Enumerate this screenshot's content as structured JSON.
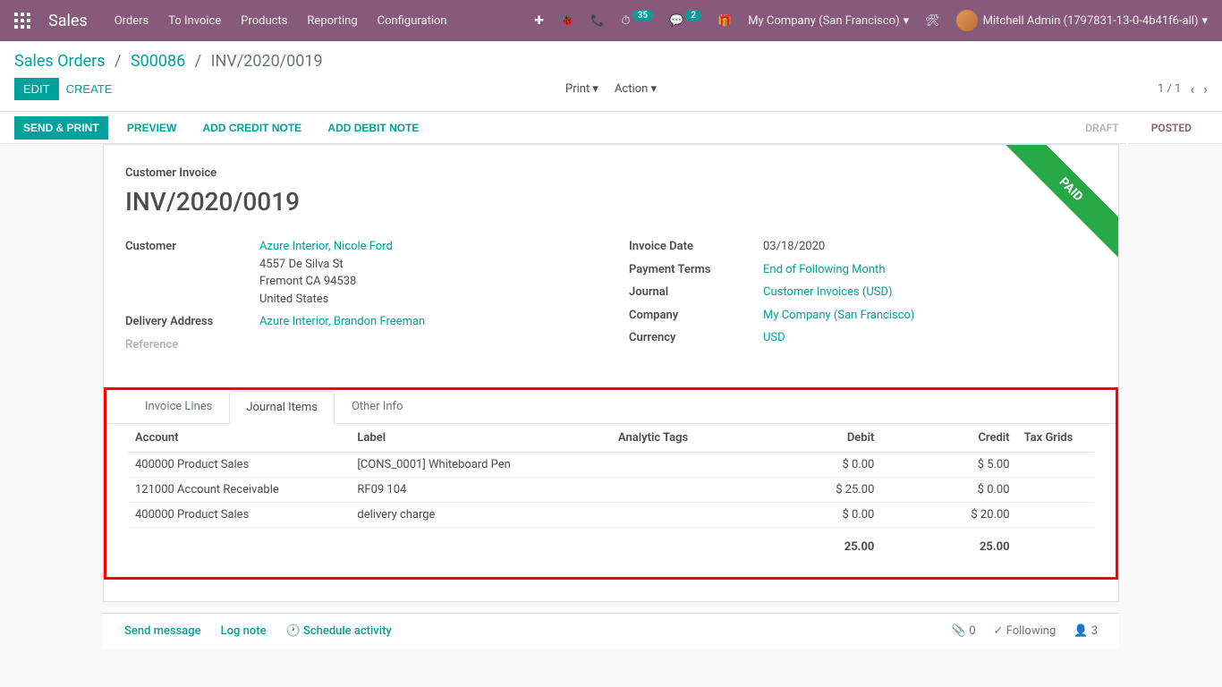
{
  "navbar": {
    "brand": "Sales",
    "menu": [
      "Orders",
      "To Invoice",
      "Products",
      "Reporting",
      "Configuration"
    ],
    "activity_badge": "35",
    "discuss_badge": "2",
    "company": "My Company (San Francisco)",
    "user": "Mitchell Admin (1797831-13-0-4b41f6-all)"
  },
  "breadcrumb": {
    "root": "Sales Orders",
    "parent": "S00086",
    "current": "INV/2020/0019"
  },
  "buttons": {
    "edit": "EDIT",
    "create": "CREATE",
    "print": "Print",
    "action": "Action",
    "send_print": "SEND & PRINT",
    "preview": "PREVIEW",
    "add_credit": "ADD CREDIT NOTE",
    "add_debit": "ADD DEBIT NOTE"
  },
  "pager": {
    "text": "1 / 1"
  },
  "status": {
    "draft": "DRAFT",
    "posted": "POSTED"
  },
  "invoice": {
    "title_label": "Customer Invoice",
    "name": "INV/2020/0019",
    "ribbon": "PAID",
    "customer_label": "Customer",
    "customer_name": "Azure Interior, Nicole Ford",
    "customer_addr1": "4557 De Silva St",
    "customer_addr2": "Fremont CA 94538",
    "customer_addr3": "United States",
    "delivery_label": "Delivery Address",
    "delivery_value": "Azure Interior, Brandon Freeman",
    "reference_label": "Reference",
    "invoice_date_label": "Invoice Date",
    "invoice_date": "03/18/2020",
    "payment_terms_label": "Payment Terms",
    "payment_terms": "End of Following Month",
    "journal_label": "Journal",
    "journal": "Customer Invoices (USD)",
    "company_label": "Company",
    "company": "My Company (San Francisco)",
    "currency_label": "Currency",
    "currency": "USD"
  },
  "tabs": {
    "invoice_lines": "Invoice Lines",
    "journal_items": "Journal Items",
    "other_info": "Other Info"
  },
  "table": {
    "headers": {
      "account": "Account",
      "label": "Label",
      "analytic": "Analytic Tags",
      "debit": "Debit",
      "credit": "Credit",
      "tax_grids": "Tax Grids"
    },
    "rows": [
      {
        "account": "400000 Product Sales",
        "label": "[CONS_0001] Whiteboard Pen",
        "debit": "$ 0.00",
        "credit": "$ 5.00"
      },
      {
        "account": "121000 Account Receivable",
        "label": "RF09 104",
        "debit": "$ 25.00",
        "credit": "$ 0.00"
      },
      {
        "account": "400000 Product Sales",
        "label": "delivery charge",
        "debit": "$ 0.00",
        "credit": "$ 20.00"
      }
    ],
    "totals": {
      "debit": "25.00",
      "credit": "25.00"
    }
  },
  "chatter": {
    "send": "Send message",
    "log": "Log note",
    "schedule": "Schedule activity",
    "attach": "0",
    "following": "Following",
    "followers": "3"
  }
}
